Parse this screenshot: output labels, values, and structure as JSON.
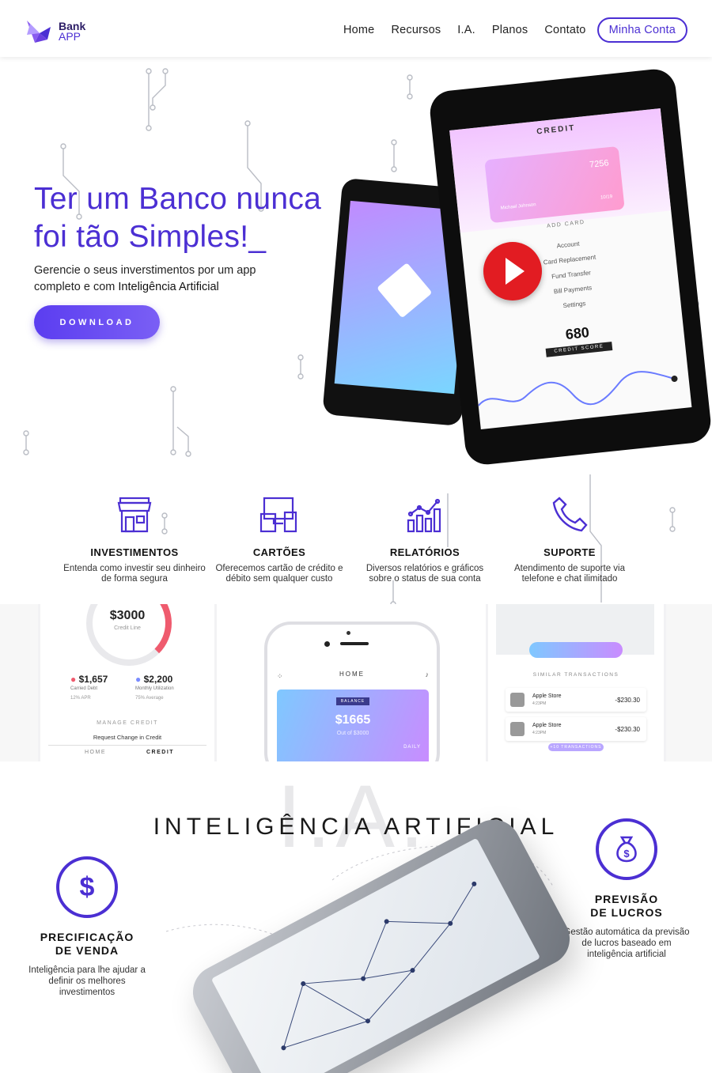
{
  "nav": {
    "logo_line1": "Bank",
    "logo_line2": "APP",
    "links": [
      "Home",
      "Recursos",
      "I.A.",
      "Planos",
      "Contato"
    ],
    "account_button": "Minha Conta"
  },
  "hero": {
    "title_line1": "Ter um Banco nunca",
    "title_line2": "foi tão Simples!_",
    "subtitle_start": "Gerencie o seus inverstimentos por um app completo e com ",
    "subtitle_highlight": "Inteligência Artificial",
    "download_button": "DOWNLOAD",
    "tablet": {
      "header": "CREDIT",
      "card_number": "7256",
      "card_holder": "Michael Johnson",
      "card_exp": "10/19",
      "add_card": "ADD CARD",
      "menu": [
        "Account",
        "Card Replacement",
        "Fund Transfer",
        "Bill Payments",
        "Settings"
      ],
      "score": "680",
      "score_label": "CREDIT SCORE"
    }
  },
  "features": [
    {
      "icon": "store-icon",
      "title": "INVESTIMENTOS",
      "desc": "Entenda como investir seu dinheiro de forma segura"
    },
    {
      "icon": "devices-icon",
      "title": "CARTÕES",
      "desc": "Oferecemos cartão de crédito e débito sem qualquer custo"
    },
    {
      "icon": "bar-chart-icon",
      "title": "RELATÓRIOS",
      "desc": "Diversos relatórios e gráficos sobre o status de sua conta"
    },
    {
      "icon": "phone-icon",
      "title": "SUPORTE",
      "desc": "Atendimento de suporte via telefone e chat ilimitado"
    }
  ],
  "screens": {
    "credit": {
      "value": "$3000",
      "value_label": "Credit Line",
      "carried_value": "$1,657",
      "carried_label": "Carried Debt",
      "carried_sub": "12% APR",
      "util_value": "$2,200",
      "util_label": "Monthly Utilization",
      "util_sub": "75% Average",
      "manage": "MANAGE CREDIT",
      "request": "Request Change in Credit",
      "tab_home": "HOME",
      "tab_credit": "CREDIT"
    },
    "home": {
      "title": "HOME",
      "balance_tag": "BALANCE",
      "balance": "$1665",
      "balance_sub": "Out of $3000",
      "daily": "DAILY"
    },
    "transactions": {
      "heading": "SIMILAR TRANSACTIONS",
      "items": [
        {
          "name": "Apple Store",
          "time": "4:23PM",
          "amount": "-$230.30"
        },
        {
          "name": "Apple Store",
          "time": "4:23PM",
          "amount": "-$230.30"
        }
      ],
      "more": "+10 TRANSACTIONS"
    }
  },
  "ia": {
    "bg_text": "I.A.",
    "title": "INTELIGÊNCIA ARTIFICIAL",
    "left": {
      "icon": "dollar-icon",
      "symbol": "$",
      "title_line1": "PRECIFICAÇÃO",
      "title_line2": "DE VENDA",
      "desc": "Inteligência para lhe ajudar a definir os melhores investimentos"
    },
    "right": {
      "icon": "money-bag-icon",
      "title_line1": "PREVISÃO",
      "title_line2": "DE LUCROS",
      "desc": "Gestão automática da previsão de lucros baseado em inteligência artificial"
    }
  },
  "colors": {
    "accent": "#4b2fd3",
    "play": "#e21c22",
    "alert": "#ef5b6e"
  }
}
